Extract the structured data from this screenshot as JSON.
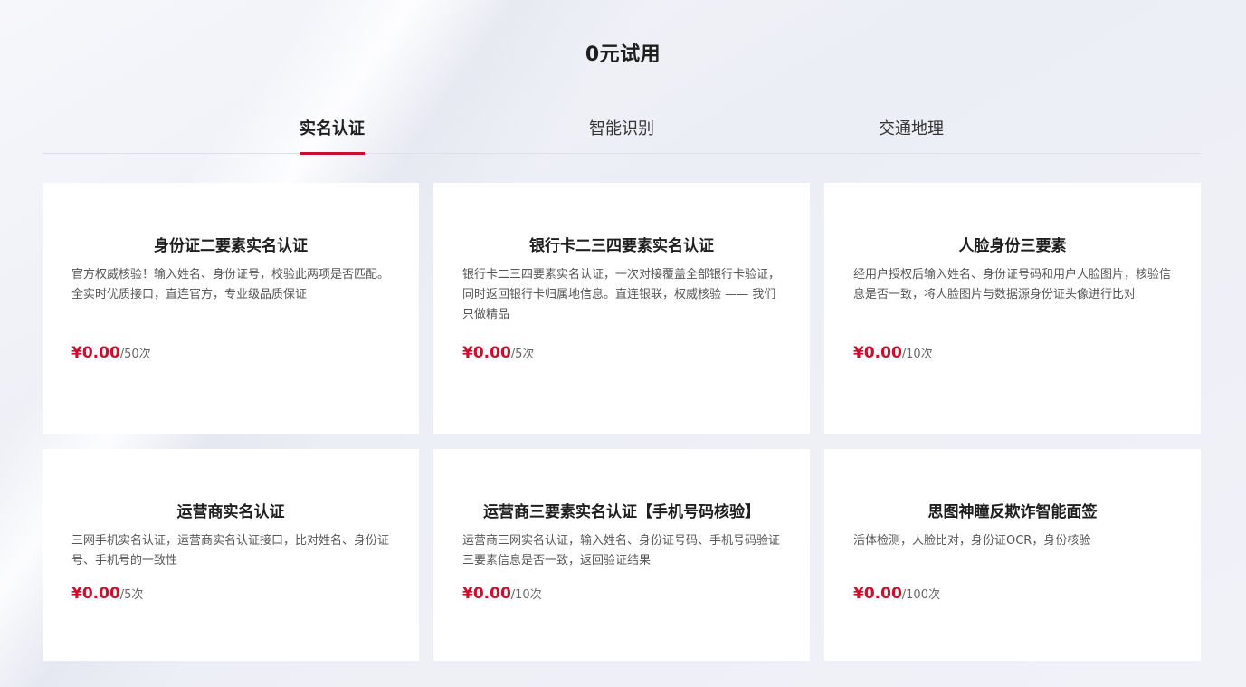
{
  "page": {
    "title": "0元试用"
  },
  "tabs": [
    {
      "label": "实名认证",
      "active": true
    },
    {
      "label": "智能识别",
      "active": false
    },
    {
      "label": "交通地理",
      "active": false
    }
  ],
  "colors": {
    "accent": "#c8102e",
    "card_bg": "#ffffff",
    "page_bg": "#eff1f7"
  },
  "cards": [
    {
      "title": "身份证二要素实名认证",
      "desc": "官方权威核验！输入姓名、身份证号，校验此两项是否匹配。全实时优质接口，直连官方，专业级品质保证",
      "price": "¥0.00",
      "unit": "/50次"
    },
    {
      "title": "银行卡二三四要素实名认证",
      "desc": "银行卡二三四要素实名认证，一次对接覆盖全部银行卡验证，同时返回银行卡归属地信息。直连银联，权威核验 —— 我们只做精品",
      "price": "¥0.00",
      "unit": "/5次"
    },
    {
      "title": "人脸身份三要素",
      "desc": "经用户授权后输入姓名、身份证号码和用户人脸图片，核验信息是否一致，将人脸图片与数据源身份证头像进行比对",
      "price": "¥0.00",
      "unit": "/10次"
    },
    {
      "title": "运营商实名认证",
      "desc": "三网手机实名认证，运营商实名认证接口，比对姓名、身份证号、手机号的一致性",
      "price": "¥0.00",
      "unit": "/5次"
    },
    {
      "title": "运营商三要素实名认证【手机号码核验】",
      "desc": "运营商三网实名认证，输入姓名、身份证号码、手机号码验证三要素信息是否一致，返回验证结果",
      "price": "¥0.00",
      "unit": "/10次"
    },
    {
      "title": "思图神瞳反欺诈智能面签",
      "desc": "活体检测，人脸比对，身份证OCR，身份核验",
      "price": "¥0.00",
      "unit": "/100次"
    }
  ]
}
